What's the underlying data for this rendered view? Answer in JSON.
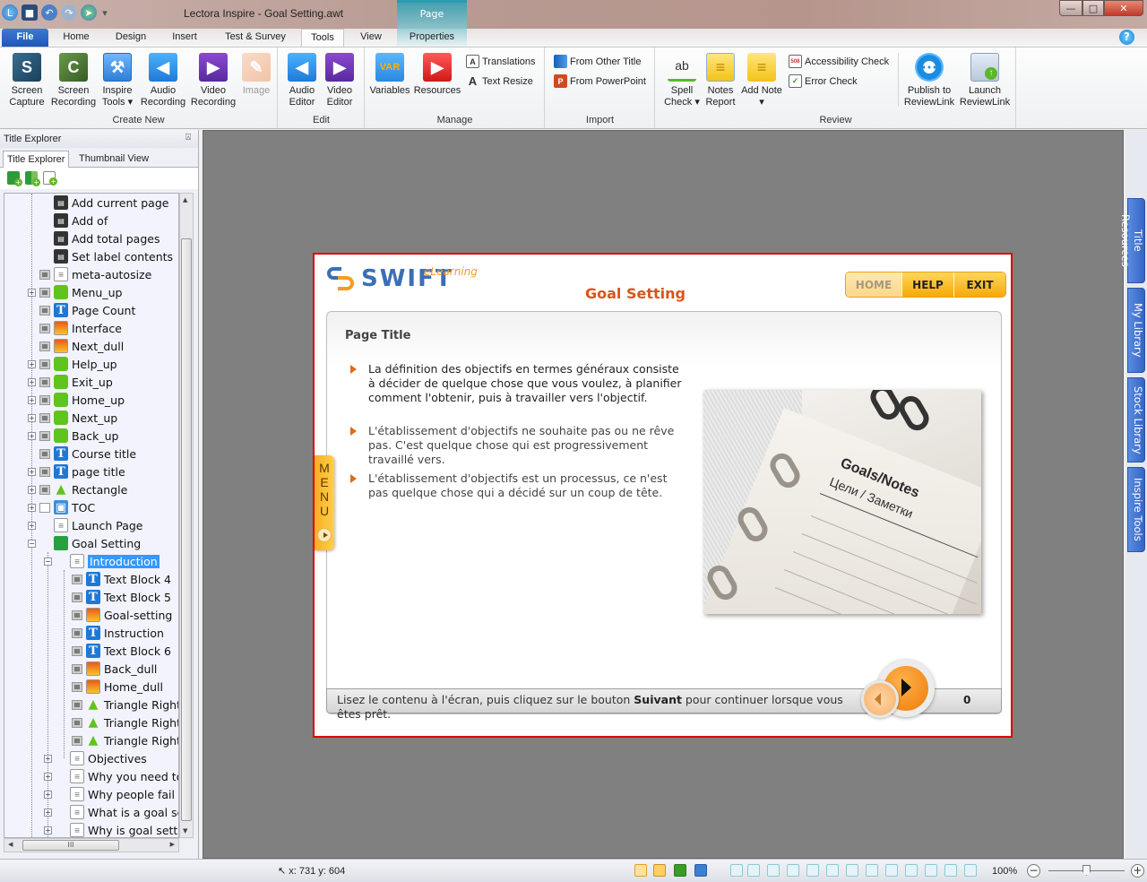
{
  "window": {
    "title": "Lectora Inspire - Goal Setting.awt",
    "contextual_tab_group": "Page",
    "controls": {
      "minimize": "—",
      "restore": "□",
      "close": "✕"
    }
  },
  "quick_access": [
    "app-icon",
    "save-icon",
    "undo-icon",
    "redo-icon",
    "publish-icon",
    "customize-dropdown-icon"
  ],
  "tabs": [
    {
      "label": "File"
    },
    {
      "label": "Home"
    },
    {
      "label": "Design"
    },
    {
      "label": "Insert"
    },
    {
      "label": "Test & Survey"
    },
    {
      "label": "Tools",
      "active": true
    },
    {
      "label": "View"
    },
    {
      "label": "Properties"
    }
  ],
  "help_label": "?",
  "ribbon": {
    "groups": {
      "create_new": {
        "label": "Create New",
        "buttons": [
          {
            "line1": "Screen",
            "line2": "Capture",
            "icon": "S"
          },
          {
            "line1": "Screen",
            "line2": "Recording",
            "icon": "C"
          },
          {
            "line1": "Inspire",
            "line2": "Tools ▾",
            "icon": "⚒"
          },
          {
            "line1": "Audio",
            "line2": "Recording",
            "icon": "◀"
          },
          {
            "line1": "Video",
            "line2": "Recording",
            "icon": "▶"
          },
          {
            "line1": "Image",
            "line2": "",
            "icon": "✎",
            "disabled": true
          }
        ]
      },
      "edit": {
        "label": "Edit",
        "buttons": [
          {
            "line1": "Audio",
            "line2": "Editor",
            "icon": "◀"
          },
          {
            "line1": "Video",
            "line2": "Editor",
            "icon": "▶"
          }
        ]
      },
      "manage": {
        "label": "Manage",
        "buttons": [
          {
            "line1": "Variables",
            "icon": "VAR"
          },
          {
            "line1": "Resources",
            "icon": "▶"
          }
        ],
        "small": [
          {
            "label": "Translations",
            "icon": "A"
          },
          {
            "label": "Text Resize",
            "icon": "A"
          }
        ]
      },
      "import": {
        "label": "Import",
        "small": [
          {
            "label": "From Other Title",
            "icon": ""
          },
          {
            "label": "From PowerPoint",
            "icon": "P"
          }
        ]
      },
      "review": {
        "label": "Review",
        "buttons": [
          {
            "line1": "Spell",
            "line2": "Check ▾",
            "icon": "ab"
          },
          {
            "line1": "Notes",
            "line2": "Report",
            "icon": "≡"
          },
          {
            "line1": "Add Note",
            "line2": "▾",
            "icon": "≡"
          },
          {
            "line1": "Publish to",
            "line2": "ReviewLink",
            "icon": "⋯"
          },
          {
            "line1": "Launch",
            "line2": "ReviewLink",
            "icon": "↑"
          }
        ],
        "small": [
          {
            "label": "Accessibility Check",
            "icon": "508"
          },
          {
            "label": "Error Check",
            "icon": "✓"
          }
        ]
      }
    }
  },
  "left_panel": {
    "title": "Title Explorer",
    "pin_icon": "⍓",
    "tabs": [
      {
        "label": "Title Explorer",
        "active": true
      },
      {
        "label": "Thumbnail View"
      }
    ],
    "toolbar": [
      "add-chapter-icon",
      "add-section-icon",
      "add-page-icon"
    ],
    "tree": [
      {
        "label": "Add current page",
        "type": "action",
        "indent": 0,
        "expander": null,
        "vis": false
      },
      {
        "label": "Add of",
        "type": "action",
        "indent": 0,
        "expander": null,
        "vis": false
      },
      {
        "label": "Add total pages",
        "type": "action",
        "indent": 0,
        "expander": null,
        "vis": false
      },
      {
        "label": "Set label contents",
        "type": "action",
        "indent": 0,
        "expander": null,
        "vis": false
      },
      {
        "label": "meta-autosize",
        "type": "page",
        "indent": 0,
        "expander": null,
        "vis": true
      },
      {
        "label": "Menu_up",
        "type": "btn",
        "indent": 0,
        "expander": "+",
        "vis": true
      },
      {
        "label": "Page Count",
        "type": "text",
        "indent": 0,
        "expander": null,
        "vis": true
      },
      {
        "label": "Interface",
        "type": "img",
        "indent": 0,
        "expander": null,
        "vis": true
      },
      {
        "label": "Next_dull",
        "type": "img",
        "indent": 0,
        "expander": null,
        "vis": true
      },
      {
        "label": "Help_up",
        "type": "btn",
        "indent": 0,
        "expander": "+",
        "vis": true
      },
      {
        "label": "Exit_up",
        "type": "btn",
        "indent": 0,
        "expander": "+",
        "vis": true
      },
      {
        "label": "Home_up",
        "type": "btn",
        "indent": 0,
        "expander": "+",
        "vis": true
      },
      {
        "label": "Next_up",
        "type": "btn",
        "indent": 0,
        "expander": "+",
        "vis": true
      },
      {
        "label": "Back_up",
        "type": "btn",
        "indent": 0,
        "expander": "+",
        "vis": true
      },
      {
        "label": "Course title",
        "type": "text",
        "indent": 0,
        "expander": null,
        "vis": true
      },
      {
        "label": "page title",
        "type": "text",
        "indent": 0,
        "expander": "+",
        "vis": true
      },
      {
        "label": "Rectangle",
        "type": "shape",
        "indent": 0,
        "expander": "+",
        "vis": true
      },
      {
        "label": "TOC",
        "type": "toc",
        "indent": 0,
        "expander": "+",
        "vis": "empty"
      },
      {
        "label": "Launch Page",
        "type": "page",
        "indent": 0,
        "expander": "+",
        "vis": false
      },
      {
        "label": "Goal Setting",
        "type": "chapter",
        "indent": 0,
        "expander": "−",
        "vis": false
      },
      {
        "label": "Introduction",
        "type": "page",
        "indent": 1,
        "expander": "−",
        "vis": false,
        "selected": true
      },
      {
        "label": "Text Block 4",
        "type": "text",
        "indent": 2,
        "expander": null,
        "vis": true
      },
      {
        "label": "Text Block 5",
        "type": "text",
        "indent": 2,
        "expander": null,
        "vis": true
      },
      {
        "label": "Goal-setting",
        "type": "img",
        "indent": 2,
        "expander": null,
        "vis": true
      },
      {
        "label": "Instruction",
        "type": "text",
        "indent": 2,
        "expander": null,
        "vis": true
      },
      {
        "label": "Text Block 6",
        "type": "text",
        "indent": 2,
        "expander": null,
        "vis": true
      },
      {
        "label": "Back_dull",
        "type": "img",
        "indent": 2,
        "expander": null,
        "vis": true
      },
      {
        "label": "Home_dull",
        "type": "img",
        "indent": 2,
        "expander": null,
        "vis": true
      },
      {
        "label": "Triangle Right",
        "type": "shape",
        "indent": 2,
        "expander": null,
        "vis": true
      },
      {
        "label": "Triangle Right",
        "type": "shape",
        "indent": 2,
        "expander": null,
        "vis": true
      },
      {
        "label": "Triangle Right",
        "type": "shape",
        "indent": 2,
        "expander": null,
        "vis": true
      },
      {
        "label": "Objectives",
        "type": "page",
        "indent": 1,
        "expander": "+",
        "vis": false
      },
      {
        "label": "Why you need to",
        "type": "page",
        "indent": 1,
        "expander": "+",
        "vis": false
      },
      {
        "label": "Why people fail t",
        "type": "page",
        "indent": 1,
        "expander": "+",
        "vis": false
      },
      {
        "label": "What is a goal se",
        "type": "page",
        "indent": 1,
        "expander": "+",
        "vis": false
      },
      {
        "label": "Why is goal settir",
        "type": "page",
        "indent": 1,
        "expander": "+",
        "vis": false
      }
    ],
    "hscroll_grip": "III"
  },
  "right_tabs": [
    "Title Resources",
    "My Library",
    "Stock Library",
    "Inspire Tools"
  ],
  "slide": {
    "logo_text": "SWIFT",
    "logo_sub": "eLearning",
    "course_title": "Goal Setting",
    "nav": {
      "home": "HOME",
      "help": "HELP",
      "exit": "EXIT"
    },
    "page_title": "Page Title",
    "bullets": [
      "La définition des objectifs en termes généraux consiste à décider de quelque chose que vous voulez, à planifier comment l'obtenir, puis à travailler vers l'objectif.",
      "L'établissement d'objectifs ne souhaite pas ou ne rêve pas. C'est quelque chose qui est progressivement travaillé vers.",
      "L'établissement d'objectifs est un processus, ce n'est pas quelque chose qui a décidé sur un coup de tête."
    ],
    "photo": {
      "title": "Goals/Notes",
      "subtitle": "Цели / Заметки"
    },
    "instruction_pre": "Lisez le contenu à l'écran, puis cliquez sur le bouton ",
    "instruction_bold": "Suivant",
    "instruction_post": " pour continuer lorsque vous êtes prêt.",
    "page_count": "0",
    "menu_label": "MENU"
  },
  "statusbar": {
    "coords": "x: 731  y: 604",
    "zoom": "100%",
    "zoom_value_percent": 100,
    "zoom_minus": "−",
    "zoom_plus": "+"
  }
}
